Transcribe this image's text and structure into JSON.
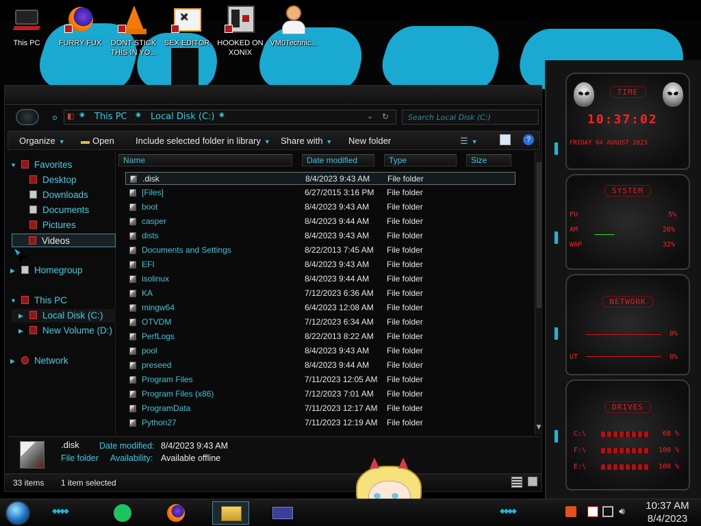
{
  "desktop": {
    "icons": [
      {
        "label": "This PC"
      },
      {
        "label": "FURRY FUX"
      },
      {
        "label": "DONT STICK THIS IN YO..."
      },
      {
        "label": "SEX EDITOR"
      },
      {
        "label": "HOOKED ON XONIX"
      },
      {
        "label": "VM0Technic..."
      }
    ]
  },
  "explorer": {
    "breadcrumb": [
      "This PC",
      "Local Disk (C:)"
    ],
    "search_placeholder": "Search Local Disk (C:)",
    "toolbar": {
      "organize": "Organize",
      "open": "Open",
      "include": "Include selected folder in library",
      "share": "Share with",
      "new_folder": "New folder"
    },
    "nav": {
      "favorites": "Favorites",
      "desktop": "Desktop",
      "downloads": "Downloads",
      "documents": "Documents",
      "pictures": "Pictures",
      "videos": "Videos",
      "homegroup": "Homegroup",
      "this_pc": "This PC",
      "local_disk": "Local Disk (C:)",
      "new_volume": "New Volume (D:)",
      "network": "Network"
    },
    "columns": {
      "name": "Name",
      "date": "Date modified",
      "type": "Type",
      "size": "Size"
    },
    "files": [
      {
        "name": ".disk",
        "date": "8/4/2023 9:43 AM",
        "type": "File folder"
      },
      {
        "name": "[Files]",
        "date": "6/27/2015 3:16 PM",
        "type": "File folder"
      },
      {
        "name": "boot",
        "date": "8/4/2023 9:43 AM",
        "type": "File folder"
      },
      {
        "name": "casper",
        "date": "8/4/2023 9:44 AM",
        "type": "File folder"
      },
      {
        "name": "dists",
        "date": "8/4/2023 9:43 AM",
        "type": "File folder"
      },
      {
        "name": "Documents and Settings",
        "date": "8/22/2013 7:45 AM",
        "type": "File folder"
      },
      {
        "name": "EFI",
        "date": "8/4/2023 9:43 AM",
        "type": "File folder"
      },
      {
        "name": "isolinux",
        "date": "8/4/2023 9:44 AM",
        "type": "File folder"
      },
      {
        "name": "KA",
        "date": "7/12/2023 6:36 AM",
        "type": "File folder"
      },
      {
        "name": "mingw64",
        "date": "6/4/2023 12:08 AM",
        "type": "File folder"
      },
      {
        "name": "OTVDM",
        "date": "7/12/2023 6:34 AM",
        "type": "File folder"
      },
      {
        "name": "PerfLogs",
        "date": "8/22/2013 8:22 AM",
        "type": "File folder"
      },
      {
        "name": "pool",
        "date": "8/4/2023 9:43 AM",
        "type": "File folder"
      },
      {
        "name": "preseed",
        "date": "8/4/2023 9:44 AM",
        "type": "File folder"
      },
      {
        "name": "Program Files",
        "date": "7/11/2023 12:05 AM",
        "type": "File folder"
      },
      {
        "name": "Program Files (x86)",
        "date": "7/12/2023 7:01 AM",
        "type": "File folder"
      },
      {
        "name": "ProgramData",
        "date": "7/11/2023 12:17 AM",
        "type": "File folder"
      },
      {
        "name": "Python27",
        "date": "7/11/2023 12:19 AM",
        "type": "File folder"
      }
    ],
    "details": {
      "name": ".disk",
      "kind": "File folder",
      "date_label": "Date modified:",
      "date_value": "8/4/2023 9:43 AM",
      "avail_label": "Availability:",
      "avail_value": "Available offline"
    },
    "status": {
      "items": "33 items",
      "selected": "1 item selected"
    }
  },
  "gadgets": {
    "time": {
      "title": "TIME",
      "clock": "10:37:02",
      "date": "FRIDAY 04 AUGUST 2023"
    },
    "system": {
      "title": "SYSTEM",
      "rows": [
        {
          "label": "PU",
          "value": "5%"
        },
        {
          "label": "AM",
          "value": "26%"
        },
        {
          "label": "WAP",
          "value": "32%"
        }
      ]
    },
    "network": {
      "title": "NETWORK",
      "rows": [
        {
          "label": "",
          "value": "0%"
        },
        {
          "label": "UT",
          "value": "0%"
        }
      ]
    },
    "drives": {
      "title": "DRIVES",
      "rows": [
        {
          "label": "C:\\",
          "value": "68 %"
        },
        {
          "label": "F:\\",
          "value": "100 %"
        },
        {
          "label": "E:\\",
          "value": "100 %"
        }
      ]
    }
  },
  "taskbar": {
    "time": "10:37 AM",
    "date": "8/4/2023"
  },
  "colors": {
    "accent": "#19a9d1",
    "text_cyan": "#3cc8e0",
    "gadget_red": "#ff2020"
  }
}
